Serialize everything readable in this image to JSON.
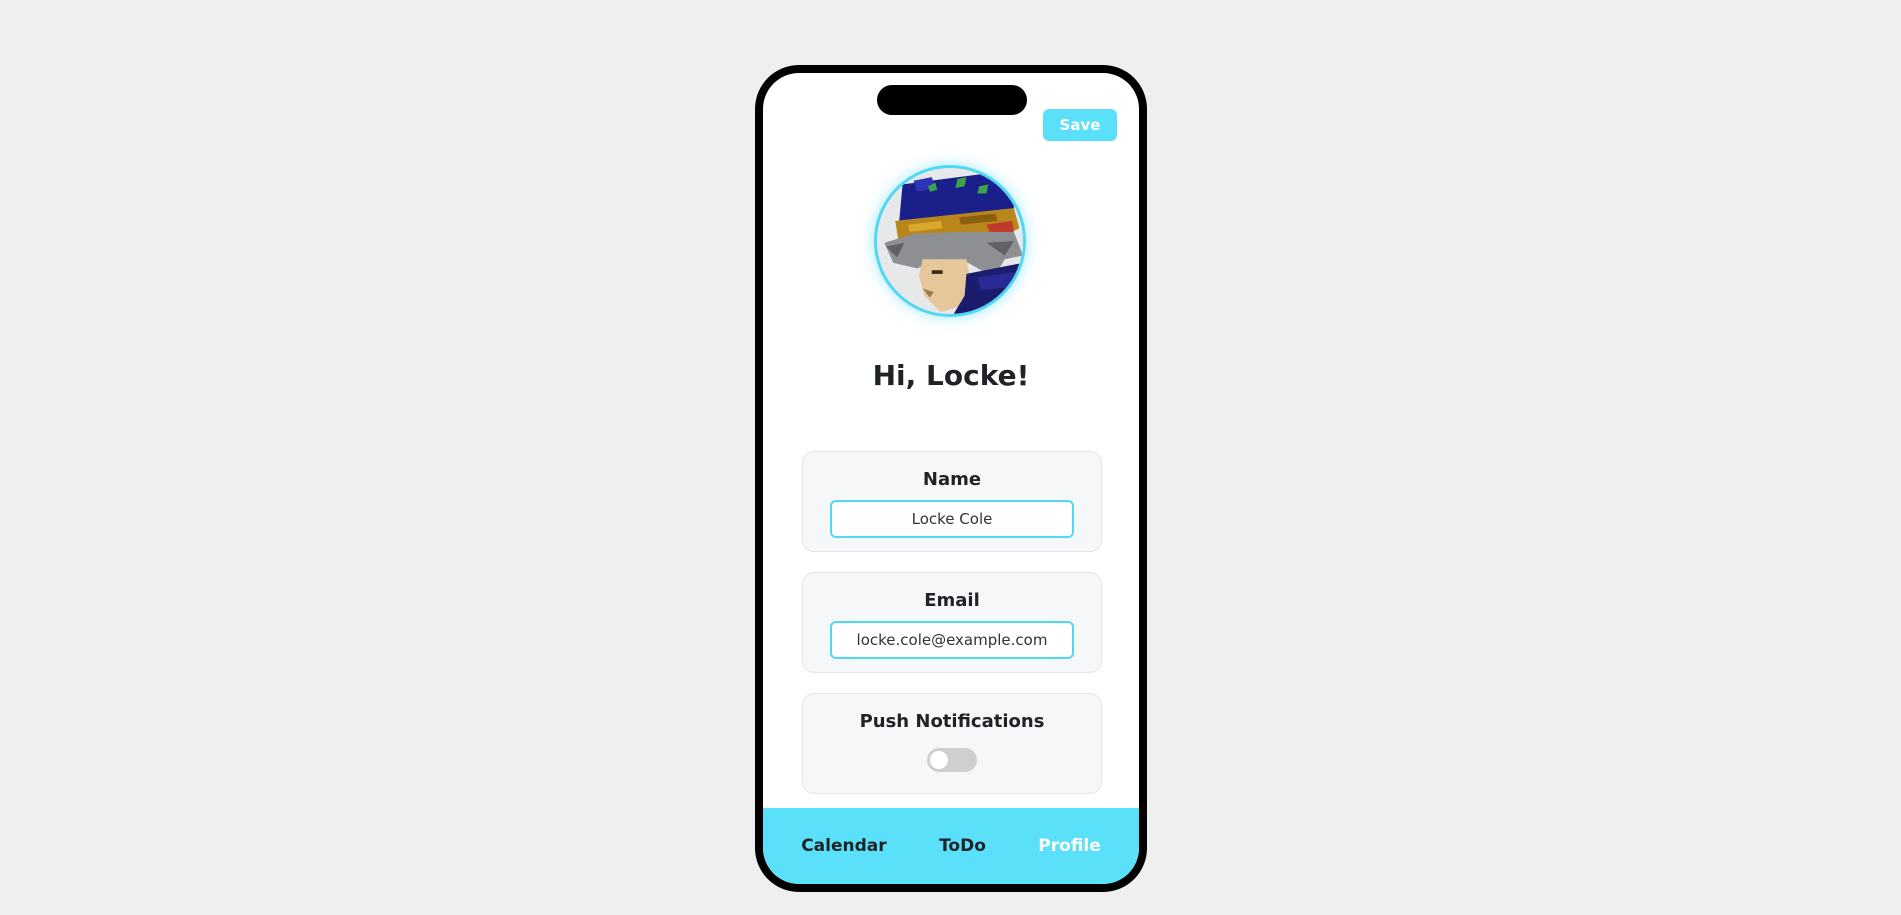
{
  "header": {
    "save_label": "Save"
  },
  "profile": {
    "avatar_icon": "pixel-art-portrait",
    "greeting": "Hi, Locke!"
  },
  "form": {
    "name": {
      "label": "Name",
      "value": "Locke Cole"
    },
    "email": {
      "label": "Email",
      "value": "locke.cole@example.com"
    },
    "push": {
      "label": "Push Notifications",
      "enabled": false
    }
  },
  "nav": {
    "items": [
      {
        "label": "Calendar",
        "active": false
      },
      {
        "label": "ToDo",
        "active": false
      },
      {
        "label": "Profile",
        "active": true
      }
    ]
  },
  "colors": {
    "accent": "#5ae0f8",
    "background": "#efefef",
    "card": "#f5f7f9",
    "toggle_off": "#cfcfcf"
  }
}
